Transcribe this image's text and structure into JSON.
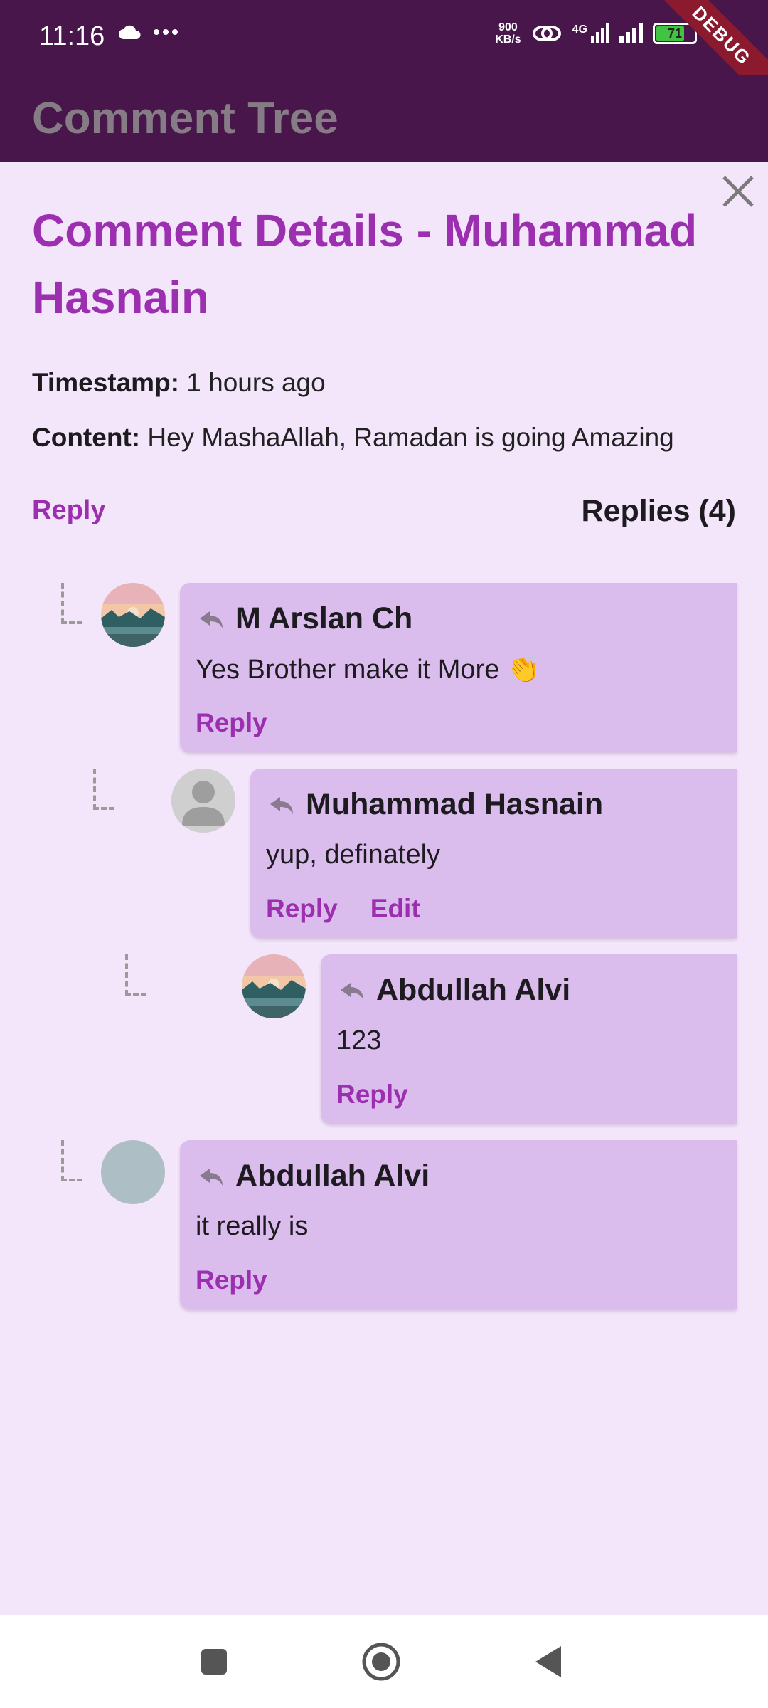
{
  "status": {
    "time": "11:16",
    "net_speed_value": "900",
    "net_speed_unit": "KB/s",
    "signal_label": "4G",
    "battery": "71",
    "debug_label": "DEBUG"
  },
  "app_bar": {
    "title": "Comment Tree"
  },
  "details": {
    "title": "Comment Details - Muhammad Hasnain",
    "timestamp_label": "Timestamp:",
    "timestamp_value": "1 hours ago",
    "content_label": "Content:",
    "content_value": "Hey MashaAllah, Ramadan is going Amazing",
    "reply_label": "Reply",
    "replies_count": "Replies (4)"
  },
  "replies": [
    {
      "name": "M Arslan Ch",
      "text": "Yes Brother make it More 👏",
      "reply_label": "Reply",
      "avatar": "landscape-photo"
    },
    {
      "name": "Muhammad Hasnain",
      "text": "yup, definately",
      "reply_label": "Reply",
      "edit_label": "Edit",
      "avatar": "default-person"
    },
    {
      "name": "Abdullah Alvi",
      "text": "123",
      "reply_label": "Reply",
      "avatar": "landscape-photo"
    },
    {
      "name": "Abdullah Alvi",
      "text": "it really is",
      "reply_label": "Reply",
      "avatar": "blank-grey"
    }
  ],
  "colors": {
    "app_bar": "#48164B",
    "accent": "#9C2FB0",
    "card": "#DBBDED",
    "background": "#F3E5FA"
  }
}
